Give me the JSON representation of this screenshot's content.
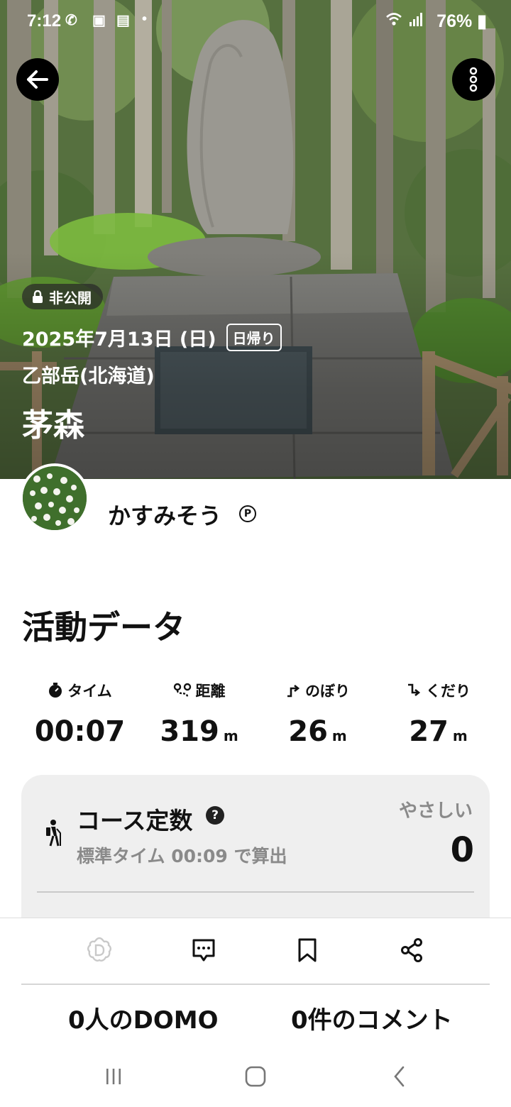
{
  "status_bar": {
    "time": "7:12",
    "battery": "76%"
  },
  "header": {
    "back_icon": "arrow-left-icon",
    "more_icon": "more-vertical-icon"
  },
  "activity": {
    "visibility_label": "非公開",
    "date": "2025年7月13日 (日)",
    "trip_type": "日帰り",
    "mountain": "乙部岳(北海道)",
    "title": "茅森"
  },
  "user": {
    "name": "かすみそう",
    "premium_badge": "P"
  },
  "activity_data": {
    "title": "活動データ",
    "stats": [
      {
        "icon": "stopwatch-icon",
        "label": "タイム",
        "value": "00:07",
        "unit": ""
      },
      {
        "icon": "route-icon",
        "label": "距離",
        "value": "319",
        "unit": "m"
      },
      {
        "icon": "ascent-icon",
        "label": "のぼり",
        "value": "26",
        "unit": "m"
      },
      {
        "icon": "descent-icon",
        "label": "くだり",
        "value": "27",
        "unit": "m"
      }
    ]
  },
  "course_constant": {
    "title": "コース定数",
    "help": "?",
    "subtitle": "標準タイム 00:09 で算出",
    "difficulty": "やさしい",
    "value": "0"
  },
  "bottom_bar": {
    "actions": [
      "domo-icon",
      "comment-icon",
      "bookmark-icon",
      "share-icon"
    ],
    "domo_count": "0人のDOMO",
    "comment_count": "0件のコメント"
  },
  "system_nav": [
    "recent-apps-icon",
    "home-icon",
    "back-nav-icon"
  ],
  "colors": {
    "accent_dark": "#000000",
    "card_bg": "#efefef",
    "muted_text": "#8a8a8a"
  }
}
